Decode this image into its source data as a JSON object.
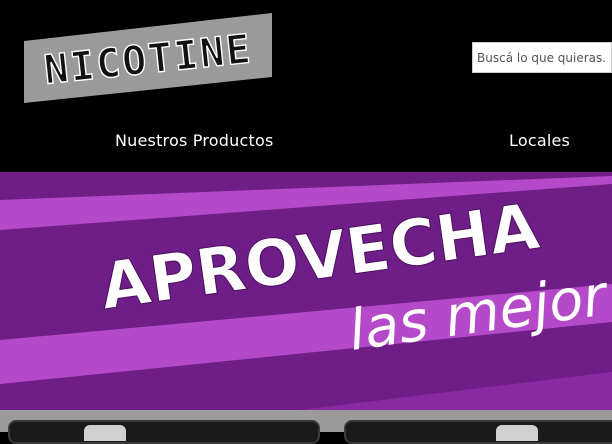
{
  "logo": {
    "text": "NICOTINE",
    "icon": "nicotine-logo"
  },
  "search": {
    "placeholder": "Buscá lo que quieras...",
    "value": ""
  },
  "nav": {
    "products_label": "Nuestros Productos",
    "locales_label": "Locales"
  },
  "banner": {
    "headline": "APROVECHA",
    "subline": "las mejor"
  },
  "colors": {
    "header_bg": "#000000",
    "banner_light": "#b44ac9",
    "banner_dark": "#6f1d87",
    "banner_text": "#ffffff",
    "strip": "#9b9b9b"
  }
}
